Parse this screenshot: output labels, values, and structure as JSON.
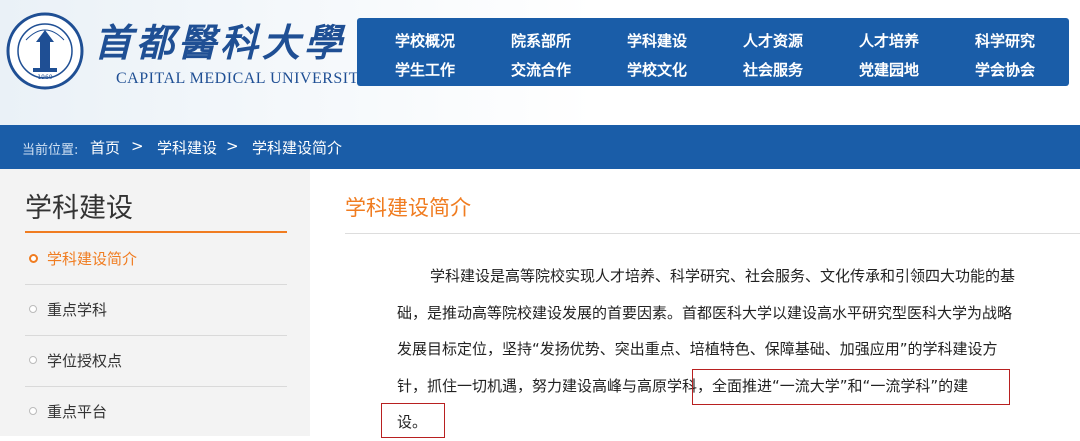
{
  "header": {
    "logo_title": "首都醫科大學",
    "logo_subtitle": "CAPITAL MEDICAL UNIVERSITY",
    "seal_year": "1960",
    "colors": {
      "brand": "#1a5da8",
      "accent": "#f07c20"
    }
  },
  "nav": {
    "row1": [
      "学校概况",
      "院系部所",
      "学科建设",
      "人才资源",
      "人才培养",
      "科学研究"
    ],
    "row2": [
      "学生工作",
      "交流合作",
      "学校文化",
      "社会服务",
      "党建园地",
      "学会协会"
    ]
  },
  "breadcrumb": {
    "label": "当前位置:",
    "items": [
      "首页",
      "学科建设",
      "学科建设简介"
    ],
    "separator": ">"
  },
  "sidebar": {
    "title": "学科建设",
    "items": [
      {
        "label": "学科建设简介",
        "active": true
      },
      {
        "label": "重点学科",
        "active": false
      },
      {
        "label": "学位授权点",
        "active": false
      },
      {
        "label": "重点平台",
        "active": false
      }
    ]
  },
  "main": {
    "title": "学科建设简介",
    "lines": [
      "学科建设是高等院校实现人才培养、科学研究、社会服务、文化传承和引领四大功能的基",
      "础，是推动高等院校建设发展的首要因素。首都医科大学以建设高水平研究型医科大学为战略",
      "发展目标定位，坚持“发扬优势、突出重点、培植特色、保障基础、加强应用”的学科建设方",
      "针，抓住一切机遇，努力建设高峰与高原学科，全面推进“一流大学”和“一流学科”的建",
      "设。"
    ]
  }
}
